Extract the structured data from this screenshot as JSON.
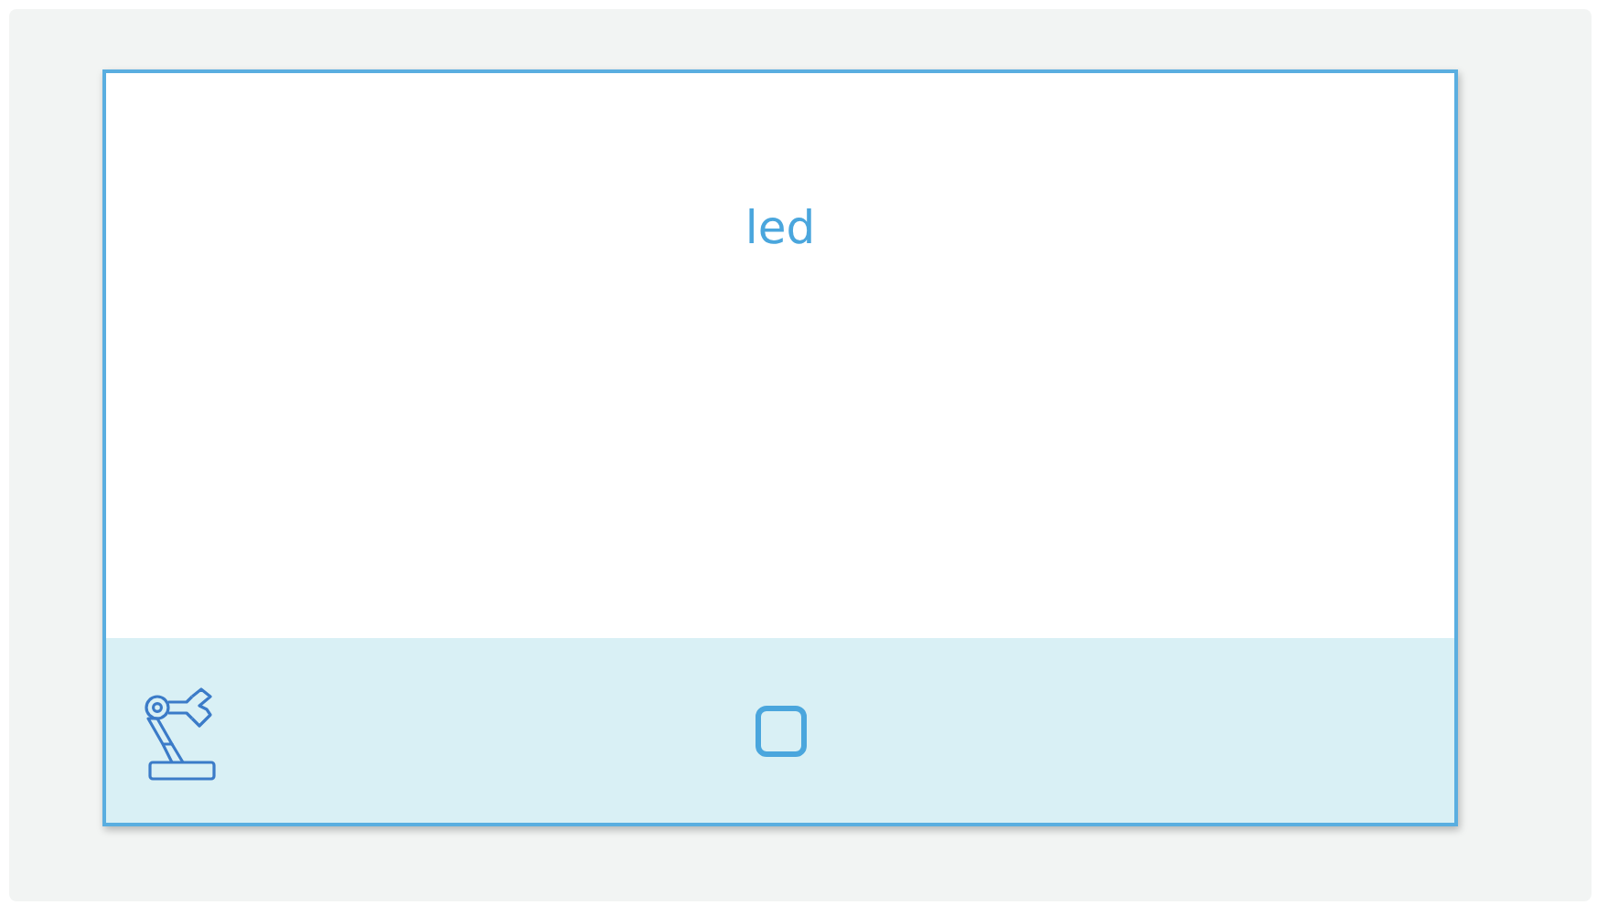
{
  "card": {
    "title": "led",
    "checkbox": {
      "checked": false
    }
  }
}
